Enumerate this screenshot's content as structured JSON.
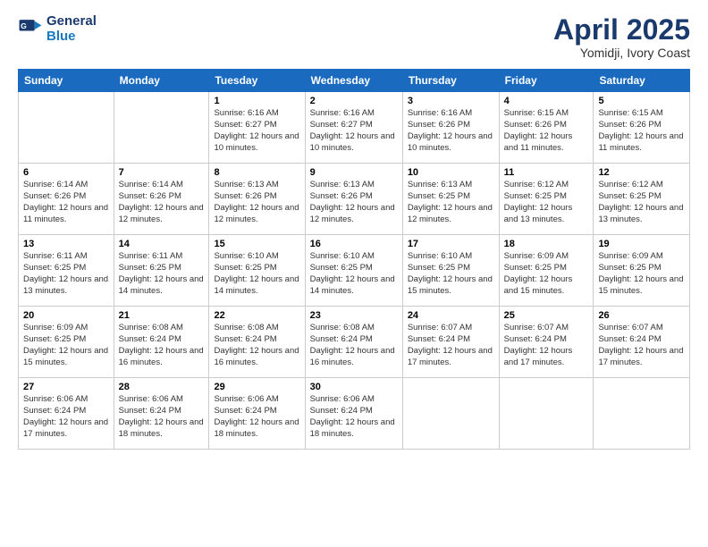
{
  "logo": {
    "line1": "General",
    "line2": "Blue"
  },
  "title": "April 2025",
  "location": "Yomidji, Ivory Coast",
  "weekdays": [
    "Sunday",
    "Monday",
    "Tuesday",
    "Wednesday",
    "Thursday",
    "Friday",
    "Saturday"
  ],
  "weeks": [
    [
      {
        "day": "",
        "info": ""
      },
      {
        "day": "",
        "info": ""
      },
      {
        "day": "1",
        "info": "Sunrise: 6:16 AM\nSunset: 6:27 PM\nDaylight: 12 hours and 10 minutes."
      },
      {
        "day": "2",
        "info": "Sunrise: 6:16 AM\nSunset: 6:27 PM\nDaylight: 12 hours and 10 minutes."
      },
      {
        "day": "3",
        "info": "Sunrise: 6:16 AM\nSunset: 6:26 PM\nDaylight: 12 hours and 10 minutes."
      },
      {
        "day": "4",
        "info": "Sunrise: 6:15 AM\nSunset: 6:26 PM\nDaylight: 12 hours and 11 minutes."
      },
      {
        "day": "5",
        "info": "Sunrise: 6:15 AM\nSunset: 6:26 PM\nDaylight: 12 hours and 11 minutes."
      }
    ],
    [
      {
        "day": "6",
        "info": "Sunrise: 6:14 AM\nSunset: 6:26 PM\nDaylight: 12 hours and 11 minutes."
      },
      {
        "day": "7",
        "info": "Sunrise: 6:14 AM\nSunset: 6:26 PM\nDaylight: 12 hours and 12 minutes."
      },
      {
        "day": "8",
        "info": "Sunrise: 6:13 AM\nSunset: 6:26 PM\nDaylight: 12 hours and 12 minutes."
      },
      {
        "day": "9",
        "info": "Sunrise: 6:13 AM\nSunset: 6:26 PM\nDaylight: 12 hours and 12 minutes."
      },
      {
        "day": "10",
        "info": "Sunrise: 6:13 AM\nSunset: 6:25 PM\nDaylight: 12 hours and 12 minutes."
      },
      {
        "day": "11",
        "info": "Sunrise: 6:12 AM\nSunset: 6:25 PM\nDaylight: 12 hours and 13 minutes."
      },
      {
        "day": "12",
        "info": "Sunrise: 6:12 AM\nSunset: 6:25 PM\nDaylight: 12 hours and 13 minutes."
      }
    ],
    [
      {
        "day": "13",
        "info": "Sunrise: 6:11 AM\nSunset: 6:25 PM\nDaylight: 12 hours and 13 minutes."
      },
      {
        "day": "14",
        "info": "Sunrise: 6:11 AM\nSunset: 6:25 PM\nDaylight: 12 hours and 14 minutes."
      },
      {
        "day": "15",
        "info": "Sunrise: 6:10 AM\nSunset: 6:25 PM\nDaylight: 12 hours and 14 minutes."
      },
      {
        "day": "16",
        "info": "Sunrise: 6:10 AM\nSunset: 6:25 PM\nDaylight: 12 hours and 14 minutes."
      },
      {
        "day": "17",
        "info": "Sunrise: 6:10 AM\nSunset: 6:25 PM\nDaylight: 12 hours and 15 minutes."
      },
      {
        "day": "18",
        "info": "Sunrise: 6:09 AM\nSunset: 6:25 PM\nDaylight: 12 hours and 15 minutes."
      },
      {
        "day": "19",
        "info": "Sunrise: 6:09 AM\nSunset: 6:25 PM\nDaylight: 12 hours and 15 minutes."
      }
    ],
    [
      {
        "day": "20",
        "info": "Sunrise: 6:09 AM\nSunset: 6:25 PM\nDaylight: 12 hours and 15 minutes."
      },
      {
        "day": "21",
        "info": "Sunrise: 6:08 AM\nSunset: 6:24 PM\nDaylight: 12 hours and 16 minutes."
      },
      {
        "day": "22",
        "info": "Sunrise: 6:08 AM\nSunset: 6:24 PM\nDaylight: 12 hours and 16 minutes."
      },
      {
        "day": "23",
        "info": "Sunrise: 6:08 AM\nSunset: 6:24 PM\nDaylight: 12 hours and 16 minutes."
      },
      {
        "day": "24",
        "info": "Sunrise: 6:07 AM\nSunset: 6:24 PM\nDaylight: 12 hours and 17 minutes."
      },
      {
        "day": "25",
        "info": "Sunrise: 6:07 AM\nSunset: 6:24 PM\nDaylight: 12 hours and 17 minutes."
      },
      {
        "day": "26",
        "info": "Sunrise: 6:07 AM\nSunset: 6:24 PM\nDaylight: 12 hours and 17 minutes."
      }
    ],
    [
      {
        "day": "27",
        "info": "Sunrise: 6:06 AM\nSunset: 6:24 PM\nDaylight: 12 hours and 17 minutes."
      },
      {
        "day": "28",
        "info": "Sunrise: 6:06 AM\nSunset: 6:24 PM\nDaylight: 12 hours and 18 minutes."
      },
      {
        "day": "29",
        "info": "Sunrise: 6:06 AM\nSunset: 6:24 PM\nDaylight: 12 hours and 18 minutes."
      },
      {
        "day": "30",
        "info": "Sunrise: 6:06 AM\nSunset: 6:24 PM\nDaylight: 12 hours and 18 minutes."
      },
      {
        "day": "",
        "info": ""
      },
      {
        "day": "",
        "info": ""
      },
      {
        "day": "",
        "info": ""
      }
    ]
  ]
}
